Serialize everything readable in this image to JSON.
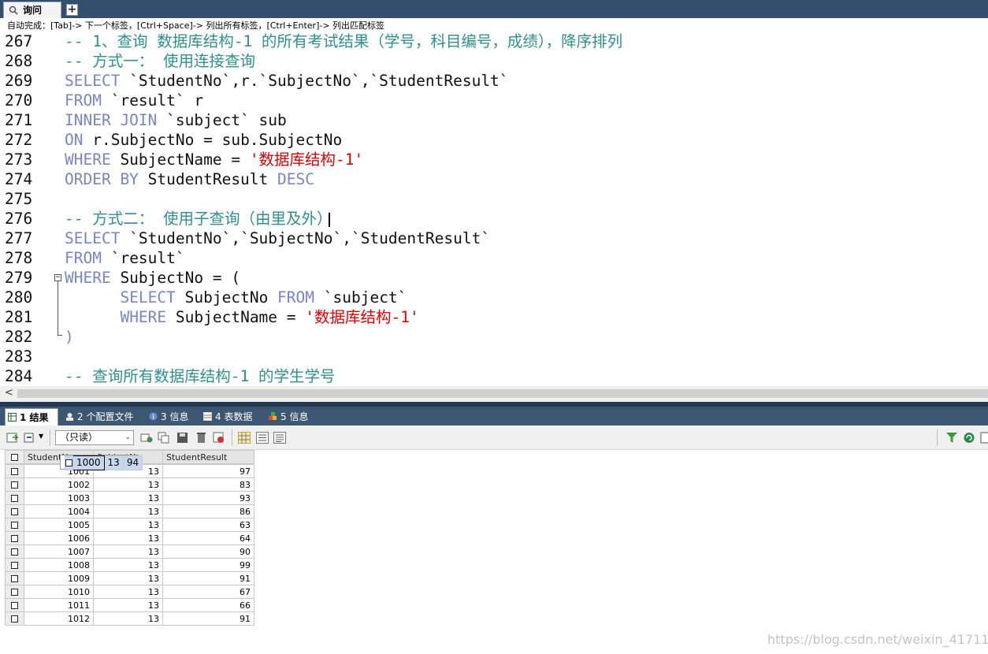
{
  "tab": {
    "title": "询问",
    "add_label": "+"
  },
  "hint": "自动完成：[Tab]-> 下一个标签，[Ctrl+Space]-> 列出所有标签，[Ctrl+Enter]-> 列出匹配标签",
  "editor": {
    "lines": [
      {
        "n": "267",
        "segs": [
          {
            "c": "cm",
            "t": "-- 1、查询 数据库结构-1 的所有考试结果（学号，科目编号，成绩），降序排列"
          }
        ]
      },
      {
        "n": "268",
        "segs": [
          {
            "c": "cm",
            "t": "-- 方式一： 使用连接查询"
          }
        ]
      },
      {
        "n": "269",
        "segs": [
          {
            "c": "kw",
            "t": "SELECT"
          },
          {
            "c": "tx",
            "t": " `StudentNo`,r.`SubjectNo`,`StudentResult`"
          }
        ]
      },
      {
        "n": "270",
        "segs": [
          {
            "c": "kw",
            "t": "FROM"
          },
          {
            "c": "tx",
            "t": " `result` r"
          }
        ]
      },
      {
        "n": "271",
        "segs": [
          {
            "c": "kw",
            "t": "INNER JOIN"
          },
          {
            "c": "tx",
            "t": " `subject` sub"
          }
        ]
      },
      {
        "n": "272",
        "segs": [
          {
            "c": "kw",
            "t": "ON"
          },
          {
            "c": "tx",
            "t": " r.SubjectNo = sub.SubjectNo"
          }
        ]
      },
      {
        "n": "273",
        "segs": [
          {
            "c": "kw",
            "t": "WHERE"
          },
          {
            "c": "tx",
            "t": " SubjectName = "
          },
          {
            "c": "st",
            "t": "'数据库结构-1'"
          }
        ]
      },
      {
        "n": "274",
        "segs": [
          {
            "c": "kw",
            "t": "ORDER BY"
          },
          {
            "c": "tx",
            "t": " StudentResult "
          },
          {
            "c": "kw",
            "t": "DESC"
          }
        ]
      },
      {
        "n": "275",
        "segs": []
      },
      {
        "n": "276",
        "segs": [
          {
            "c": "cm",
            "t": "-- 方式二： 使用子查询（由里及外）"
          }
        ]
      },
      {
        "n": "277",
        "segs": [
          {
            "c": "kw",
            "t": "SELECT"
          },
          {
            "c": "tx",
            "t": " `StudentNo`,`SubjectNo`,`StudentResult`"
          }
        ]
      },
      {
        "n": "278",
        "segs": [
          {
            "c": "kw",
            "t": "FROM"
          },
          {
            "c": "tx",
            "t": " `result`"
          }
        ]
      },
      {
        "n": "279",
        "segs": [
          {
            "c": "kw",
            "t": "WHERE"
          },
          {
            "c": "tx",
            "t": " SubjectNo = ("
          }
        ]
      },
      {
        "n": "280",
        "segs": [
          {
            "c": "tx",
            "t": "      "
          },
          {
            "c": "kw",
            "t": "SELECT"
          },
          {
            "c": "tx",
            "t": " SubjectNo "
          },
          {
            "c": "kw",
            "t": "FROM"
          },
          {
            "c": "tx",
            "t": " `subject`"
          }
        ]
      },
      {
        "n": "281",
        "segs": [
          {
            "c": "tx",
            "t": "      "
          },
          {
            "c": "kw",
            "t": "WHERE"
          },
          {
            "c": "tx",
            "t": " SubjectName = "
          },
          {
            "c": "st",
            "t": "'数据库结构-1'"
          }
        ]
      },
      {
        "n": "282",
        "segs": [
          {
            "c": "kw",
            "t": ")"
          }
        ]
      },
      {
        "n": "283",
        "segs": []
      },
      {
        "n": "284",
        "segs": [
          {
            "c": "cm",
            "t": "-- 查询所有数据库结构-1 的学生学号"
          }
        ]
      }
    ]
  },
  "scroll_arrow": "<",
  "result_tabs": [
    {
      "label": "1 结果",
      "active": true
    },
    {
      "label": "2 个配置文件",
      "active": false
    },
    {
      "label": "3 信息",
      "active": false
    },
    {
      "label": "4 表数据",
      "active": false
    },
    {
      "label": "5 信息",
      "active": false
    }
  ],
  "toolbar": {
    "readonly_select": "（只读）"
  },
  "grid": {
    "columns": [
      "StudentNo",
      "SubjectNo",
      "StudentResult"
    ],
    "rows": [
      [
        "1000",
        "13",
        "94"
      ],
      [
        "1001",
        "13",
        "97"
      ],
      [
        "1002",
        "13",
        "83"
      ],
      [
        "1003",
        "13",
        "93"
      ],
      [
        "1004",
        "13",
        "86"
      ],
      [
        "1005",
        "13",
        "63"
      ],
      [
        "1006",
        "13",
        "64"
      ],
      [
        "1007",
        "13",
        "90"
      ],
      [
        "1008",
        "13",
        "99"
      ],
      [
        "1009",
        "13",
        "91"
      ],
      [
        "1010",
        "13",
        "67"
      ],
      [
        "1011",
        "13",
        "66"
      ],
      [
        "1012",
        "13",
        "91"
      ]
    ]
  },
  "watermark": "https://blog.csdn.net/weixin_41711992"
}
